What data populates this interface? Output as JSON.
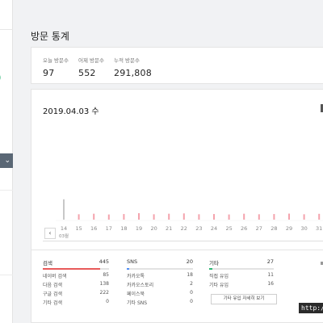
{
  "page_title": "방문 통계",
  "summary": {
    "today_label": "오늘 방문수",
    "today_value": "97",
    "yesterday_label": "어제 방문수",
    "yesterday_value": "552",
    "total_label": "누적 방문수",
    "total_value": "291,808"
  },
  "chart": {
    "date_title": "2019.04.03 수",
    "prev_icon": "‹",
    "month_label": "03월",
    "selected_day": "14"
  },
  "chart_data": {
    "type": "bar",
    "categories": [
      "14",
      "15",
      "16",
      "17",
      "18",
      "19",
      "20",
      "21",
      "22",
      "23",
      "24",
      "25",
      "26",
      "27",
      "28",
      "29",
      "30",
      "31"
    ],
    "values": [
      450,
      50,
      55,
      48,
      52,
      60,
      50,
      55,
      58,
      50,
      52,
      48,
      55,
      50,
      52,
      56,
      50,
      54
    ],
    "colors": {
      "bar": "#f4a3ad",
      "selected_bar": "#c8c8c8"
    }
  },
  "categories": {
    "search": {
      "label": "검색",
      "total": "445",
      "accent": "#e85a5a",
      "share": 0.86,
      "rows": [
        {
          "name": "네이버 검색",
          "value": "85"
        },
        {
          "name": "다음 검색",
          "value": "138"
        },
        {
          "name": "구글 검색",
          "value": "222"
        },
        {
          "name": "기타 검색",
          "value": "0"
        }
      ]
    },
    "sns": {
      "label": "SNS",
      "total": "20",
      "accent": "#4f8df5",
      "share": 0.04,
      "rows": [
        {
          "name": "카카오톡",
          "value": "18"
        },
        {
          "name": "카카오스토리",
          "value": "2"
        },
        {
          "name": "페이스북",
          "value": "0"
        },
        {
          "name": "기타 SNS",
          "value": "0"
        }
      ]
    },
    "etc": {
      "label": "기타",
      "total": "27",
      "accent": "#2bb673",
      "share": 0.05,
      "rows": [
        {
          "name": "직접 유입",
          "value": "11"
        },
        {
          "name": "기타 유입",
          "value": "16"
        }
      ],
      "detail_button": "기타 유입 자세히 보기"
    }
  },
  "watermark": {
    "url_text": "http://"
  }
}
